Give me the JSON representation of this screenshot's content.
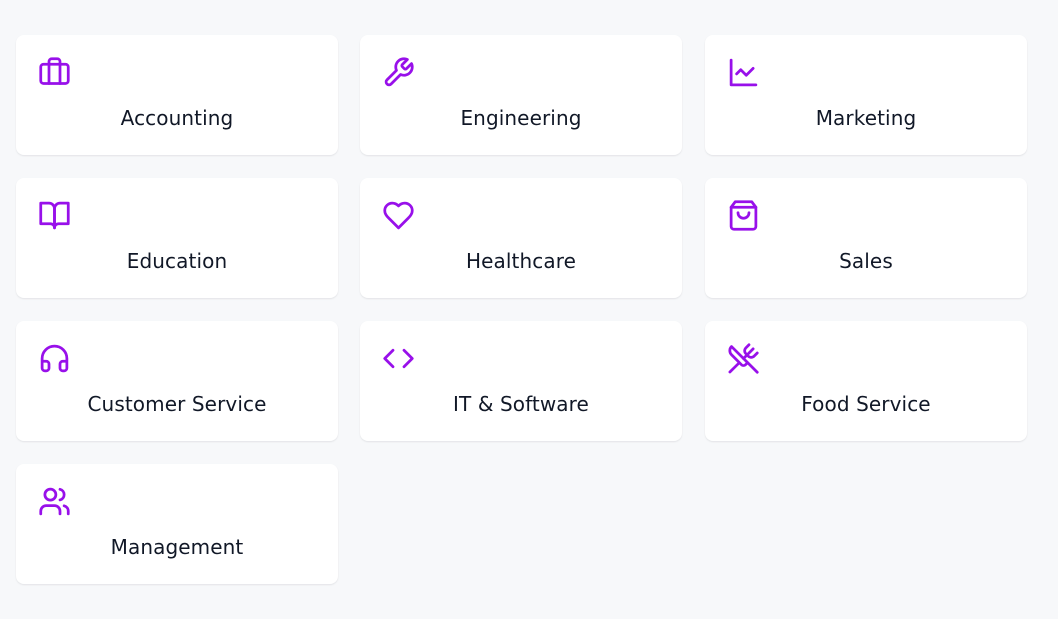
{
  "accent_color": "#9810ea",
  "categories": [
    {
      "label": "Accounting",
      "icon": "briefcase-icon"
    },
    {
      "label": "Engineering",
      "icon": "wrench-icon"
    },
    {
      "label": "Marketing",
      "icon": "line-chart-icon"
    },
    {
      "label": "Education",
      "icon": "open-book-icon"
    },
    {
      "label": "Healthcare",
      "icon": "heart-icon"
    },
    {
      "label": "Sales",
      "icon": "shopping-bag-icon"
    },
    {
      "label": "Customer Service",
      "icon": "headphones-icon"
    },
    {
      "label": "IT & Software",
      "icon": "code-icon"
    },
    {
      "label": "Food Service",
      "icon": "utensils-crossed-icon"
    },
    {
      "label": "Management",
      "icon": "users-icon"
    }
  ]
}
